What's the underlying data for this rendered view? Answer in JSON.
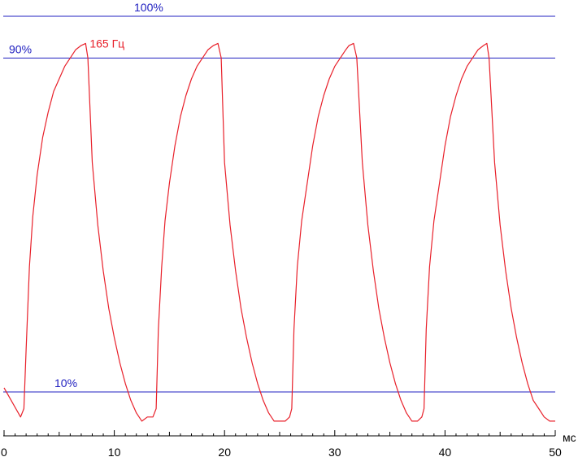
{
  "chart_data": {
    "type": "line",
    "xlabel": "мс",
    "xlim": [
      0,
      50
    ],
    "ylim": [
      -3,
      105
    ],
    "x_ticks": [
      0,
      10,
      20,
      30,
      40,
      50
    ],
    "x_tick_labels": [
      "0",
      "10",
      "20",
      "30",
      "40",
      "50"
    ],
    "reference_lines": [
      {
        "label": "100%",
        "y": 100
      },
      {
        "label": "90%",
        "y": 90
      },
      {
        "label": "10%",
        "y": 10
      }
    ],
    "series": [
      {
        "name": "165 Гц",
        "color": "#e8202a",
        "x": [
          0.0,
          1.5,
          1.8,
          2.0,
          2.3,
          2.6,
          3.0,
          3.5,
          4.0,
          4.5,
          5.0,
          5.5,
          6.0,
          6.5,
          7.0,
          7.4,
          7.6,
          8.0,
          8.5,
          9.0,
          9.5,
          10.0,
          10.5,
          11.0,
          11.5,
          12.0,
          12.5,
          13.0,
          13.5,
          13.8,
          14.0,
          14.3,
          14.6,
          15.0,
          15.5,
          16.0,
          16.5,
          17.0,
          17.5,
          18.0,
          18.5,
          19.0,
          19.4,
          19.7,
          20.0,
          20.5,
          21.0,
          21.5,
          22.0,
          22.5,
          23.0,
          23.5,
          24.0,
          24.5,
          25.0,
          25.5,
          25.9,
          26.1,
          26.3,
          26.6,
          27.0,
          27.5,
          28.0,
          28.5,
          29.0,
          29.5,
          30.0,
          30.5,
          31.0,
          31.3,
          31.7,
          32.0,
          32.5,
          33.0,
          33.5,
          34.0,
          34.5,
          35.0,
          35.5,
          36.0,
          36.5,
          37.0,
          37.5,
          37.9,
          38.1,
          38.3,
          38.6,
          39.0,
          39.5,
          40.0,
          40.5,
          41.0,
          41.5,
          42.0,
          42.5,
          43.0,
          43.5,
          43.8,
          44.0,
          44.5,
          45.0,
          45.5,
          46.0,
          46.5,
          47.0,
          47.5,
          48.0,
          48.5,
          49.0,
          49.5,
          50.0
        ],
        "y": [
          11,
          4,
          6,
          20,
          40,
          52,
          62,
          71,
          77,
          82,
          85,
          88,
          90,
          92,
          93,
          93.5,
          90,
          65,
          50,
          39,
          30,
          23,
          17,
          12,
          8,
          5,
          3,
          4,
          4,
          6,
          25,
          40,
          51,
          60,
          69,
          76,
          81,
          85,
          88,
          90,
          92,
          93,
          93.5,
          90,
          65,
          50,
          39,
          30,
          23,
          17,
          12,
          8,
          5,
          3,
          3,
          3,
          4,
          6,
          25,
          40,
          51,
          60,
          69,
          76,
          81,
          85,
          88,
          90,
          92,
          93,
          93.5,
          90,
          65,
          50,
          39,
          30,
          23,
          17,
          12,
          8,
          5,
          3,
          3,
          4,
          6,
          25,
          40,
          51,
          60,
          69,
          76,
          81,
          85,
          88,
          90,
          92,
          93,
          93.5,
          90,
          65,
          50,
          39,
          30,
          23,
          17,
          12,
          8,
          6,
          4,
          3,
          3
        ]
      }
    ]
  }
}
